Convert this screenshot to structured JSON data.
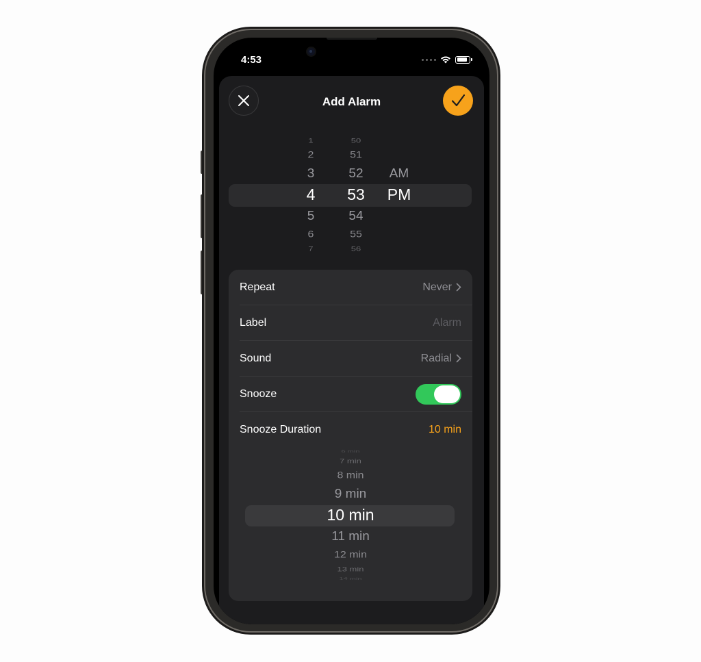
{
  "status_bar": {
    "time": "4:53"
  },
  "sheet": {
    "title": "Add Alarm",
    "close_icon": "close-icon",
    "confirm_icon": "checkmark-icon",
    "accent_color": "#f7a21b"
  },
  "time_picker": {
    "hours": [
      "1",
      "2",
      "3",
      "4",
      "5",
      "6",
      "7"
    ],
    "minutes": [
      "50",
      "51",
      "52",
      "53",
      "54",
      "55",
      "56"
    ],
    "ampm": [
      "AM",
      "PM"
    ],
    "selected_hour": "4",
    "selected_minute": "53",
    "selected_period": "PM"
  },
  "settings": {
    "repeat": {
      "label": "Repeat",
      "value": "Never"
    },
    "label": {
      "label": "Label",
      "placeholder": "Alarm"
    },
    "sound": {
      "label": "Sound",
      "value": "Radial"
    },
    "snooze": {
      "label": "Snooze",
      "on": true,
      "on_color": "#32c85a"
    },
    "snooze_duration": {
      "label": "Snooze Duration",
      "value": "10 min"
    }
  },
  "duration_picker": {
    "options": [
      "6 min",
      "7 min",
      "8 min",
      "9 min",
      "10 min",
      "11 min",
      "12 min",
      "13 min",
      "14 min"
    ],
    "selected": "10 min"
  }
}
